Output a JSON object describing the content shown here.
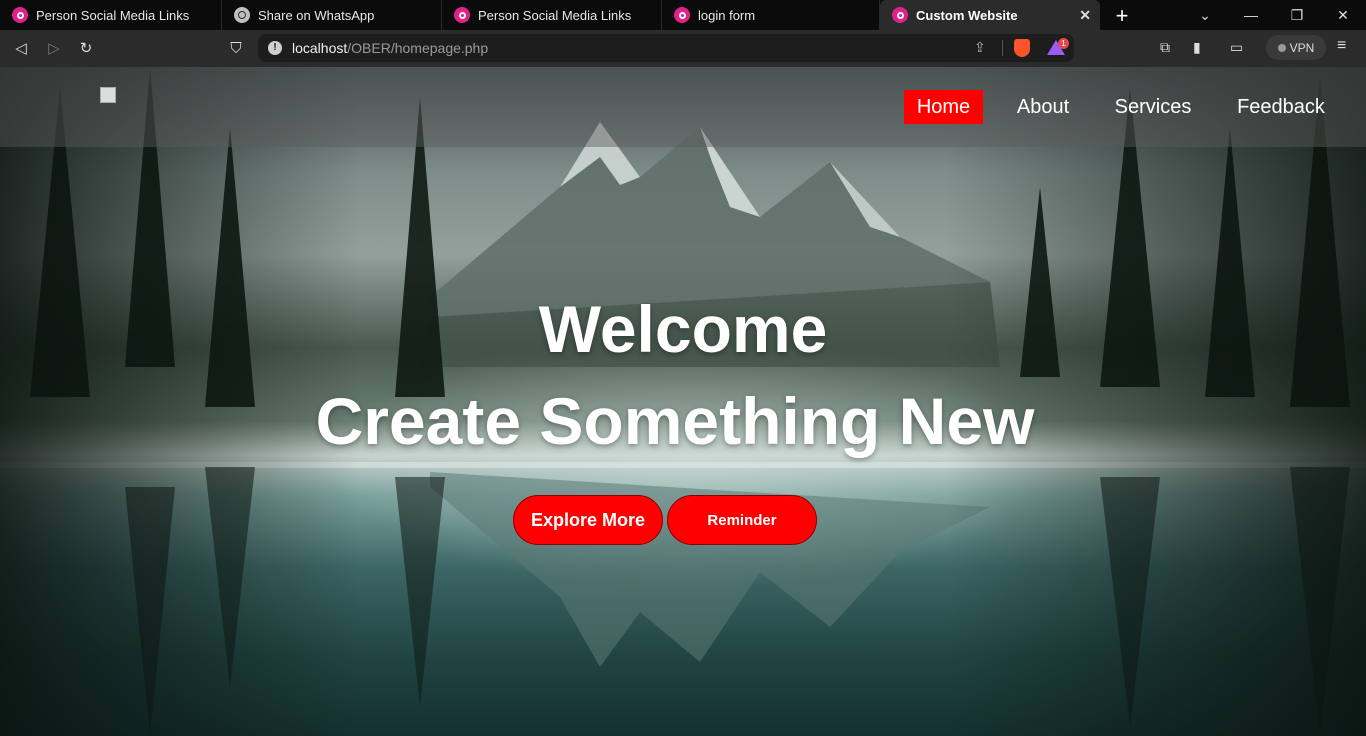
{
  "tabs": [
    {
      "title": "Person Social Media Links",
      "icon": "app-icon"
    },
    {
      "title": "Share on WhatsApp",
      "icon": "globe-icon"
    },
    {
      "title": "Person Social Media Links",
      "icon": "app-icon"
    },
    {
      "title": "login form",
      "icon": "app-icon"
    },
    {
      "title": "Custom Website",
      "icon": "app-icon",
      "active": true
    }
  ],
  "address": {
    "host": "localhost",
    "path": "/OBER/homepage.php"
  },
  "toolbar": {
    "vpn_label": "VPN",
    "rewards_badge": "1"
  },
  "nav": {
    "home": "Home",
    "about": "About",
    "services": "Services",
    "feedback": "Feedback"
  },
  "hero": {
    "line1": "Welcome",
    "line2": "Create Something New"
  },
  "buttons": {
    "explore": "Explore More",
    "reminder": "Reminder"
  },
  "colors": {
    "accent": "#ff0000",
    "text": "#ffffff"
  }
}
